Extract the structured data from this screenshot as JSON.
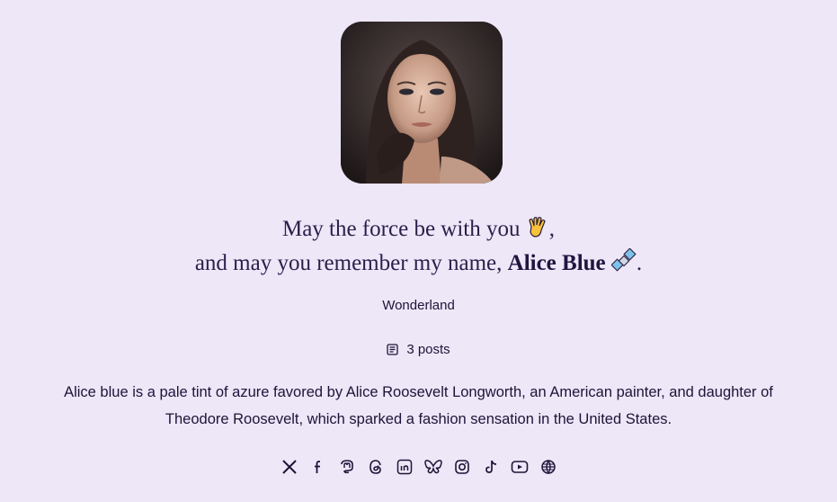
{
  "profile": {
    "headline_line1": "May the force be with you",
    "headline_line1_end": ",",
    "headline_line2_pre": "and may you remember my name,",
    "name": "Alice Blue",
    "headline_line2_end": ".",
    "location": "Wonderland",
    "posts_label": "3 posts",
    "bio": "Alice blue is a pale tint of azure favored by Alice Roosevelt Longworth, an American painter, and daughter of Theodore Roosevelt, which sparked a fashion sensation in the United States."
  },
  "icons": {
    "emoji1": "vulcan-salute-emoji",
    "emoji2": "satellite-emoji",
    "posts": "document-icon"
  },
  "social": [
    "x",
    "facebook",
    "mastodon",
    "threads",
    "linkedin",
    "bluesky",
    "instagram",
    "tiktok",
    "youtube",
    "website"
  ],
  "colors": {
    "background": "#ede7f8",
    "text": "#1e1438"
  }
}
